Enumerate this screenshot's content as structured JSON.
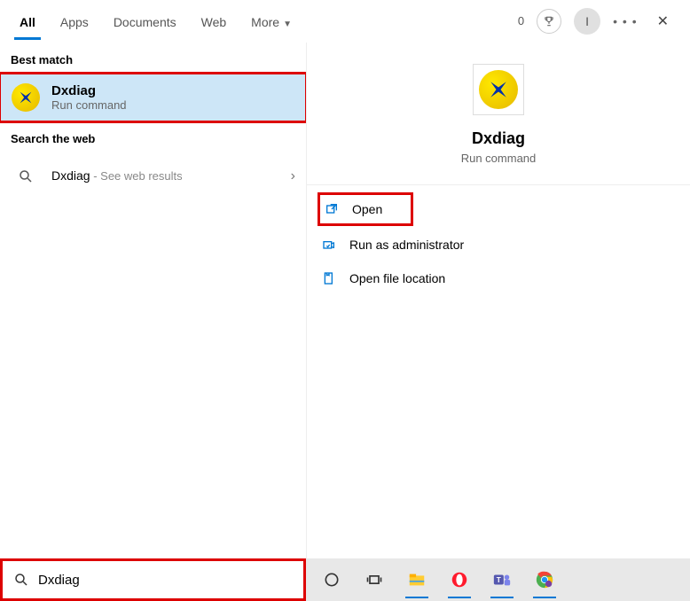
{
  "header": {
    "tabs": [
      "All",
      "Apps",
      "Documents",
      "Web",
      "More"
    ],
    "points": "0",
    "avatar_initial": "I"
  },
  "left": {
    "best_match_label": "Best match",
    "result": {
      "title": "Dxdiag",
      "subtitle": "Run command"
    },
    "search_web_label": "Search the web",
    "web_result": {
      "title": "Dxdiag",
      "suffix": " - See web results"
    }
  },
  "right": {
    "title": "Dxdiag",
    "subtitle": "Run command",
    "actions": {
      "open": "Open",
      "run_admin": "Run as administrator",
      "open_location": "Open file location"
    }
  },
  "search": {
    "value": "Dxdiag"
  },
  "icons": {
    "dxdiag": "dxdiag-icon",
    "search": "search-icon",
    "chevron_right": "chevron-right-icon",
    "chevron_down": "chevron-down-icon",
    "open": "open-icon",
    "shield": "shield-icon",
    "folder": "folder-icon",
    "trophy": "trophy-icon",
    "close": "close-icon",
    "ellipsis": "ellipsis-icon",
    "cortana": "cortana-icon",
    "taskview": "taskview-icon",
    "explorer": "explorer-icon",
    "opera": "opera-icon",
    "teams": "teams-icon",
    "chrome": "chrome-icon"
  }
}
